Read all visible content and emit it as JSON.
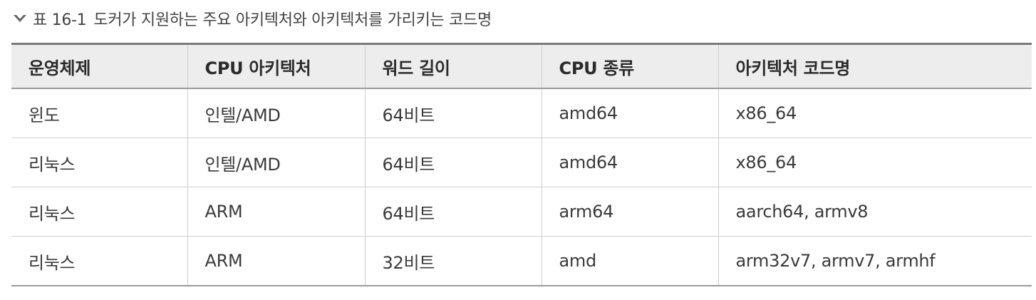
{
  "caption": {
    "icon": "chevron-down-icon",
    "label": "표 16-1",
    "title": "도커가 지원하는 주요 아키텍처와 아키텍처를 가리키는 코드명"
  },
  "table": {
    "headers": [
      "운영체제",
      "CPU 아키텍처",
      "워드 길이",
      "CPU 종류",
      "아키텍처 코드명"
    ],
    "rows": [
      [
        "윈도",
        "인텔/AMD",
        "64비트",
        "amd64",
        "x86_64"
      ],
      [
        "리눅스",
        "인텔/AMD",
        "64비트",
        "amd64",
        "x86_64"
      ],
      [
        "리눅스",
        "ARM",
        "64비트",
        "arm64",
        "aarch64, armv8"
      ],
      [
        "리눅스",
        "ARM",
        "32비트",
        "amd",
        "arm32v7, armv7, armhf"
      ]
    ]
  }
}
